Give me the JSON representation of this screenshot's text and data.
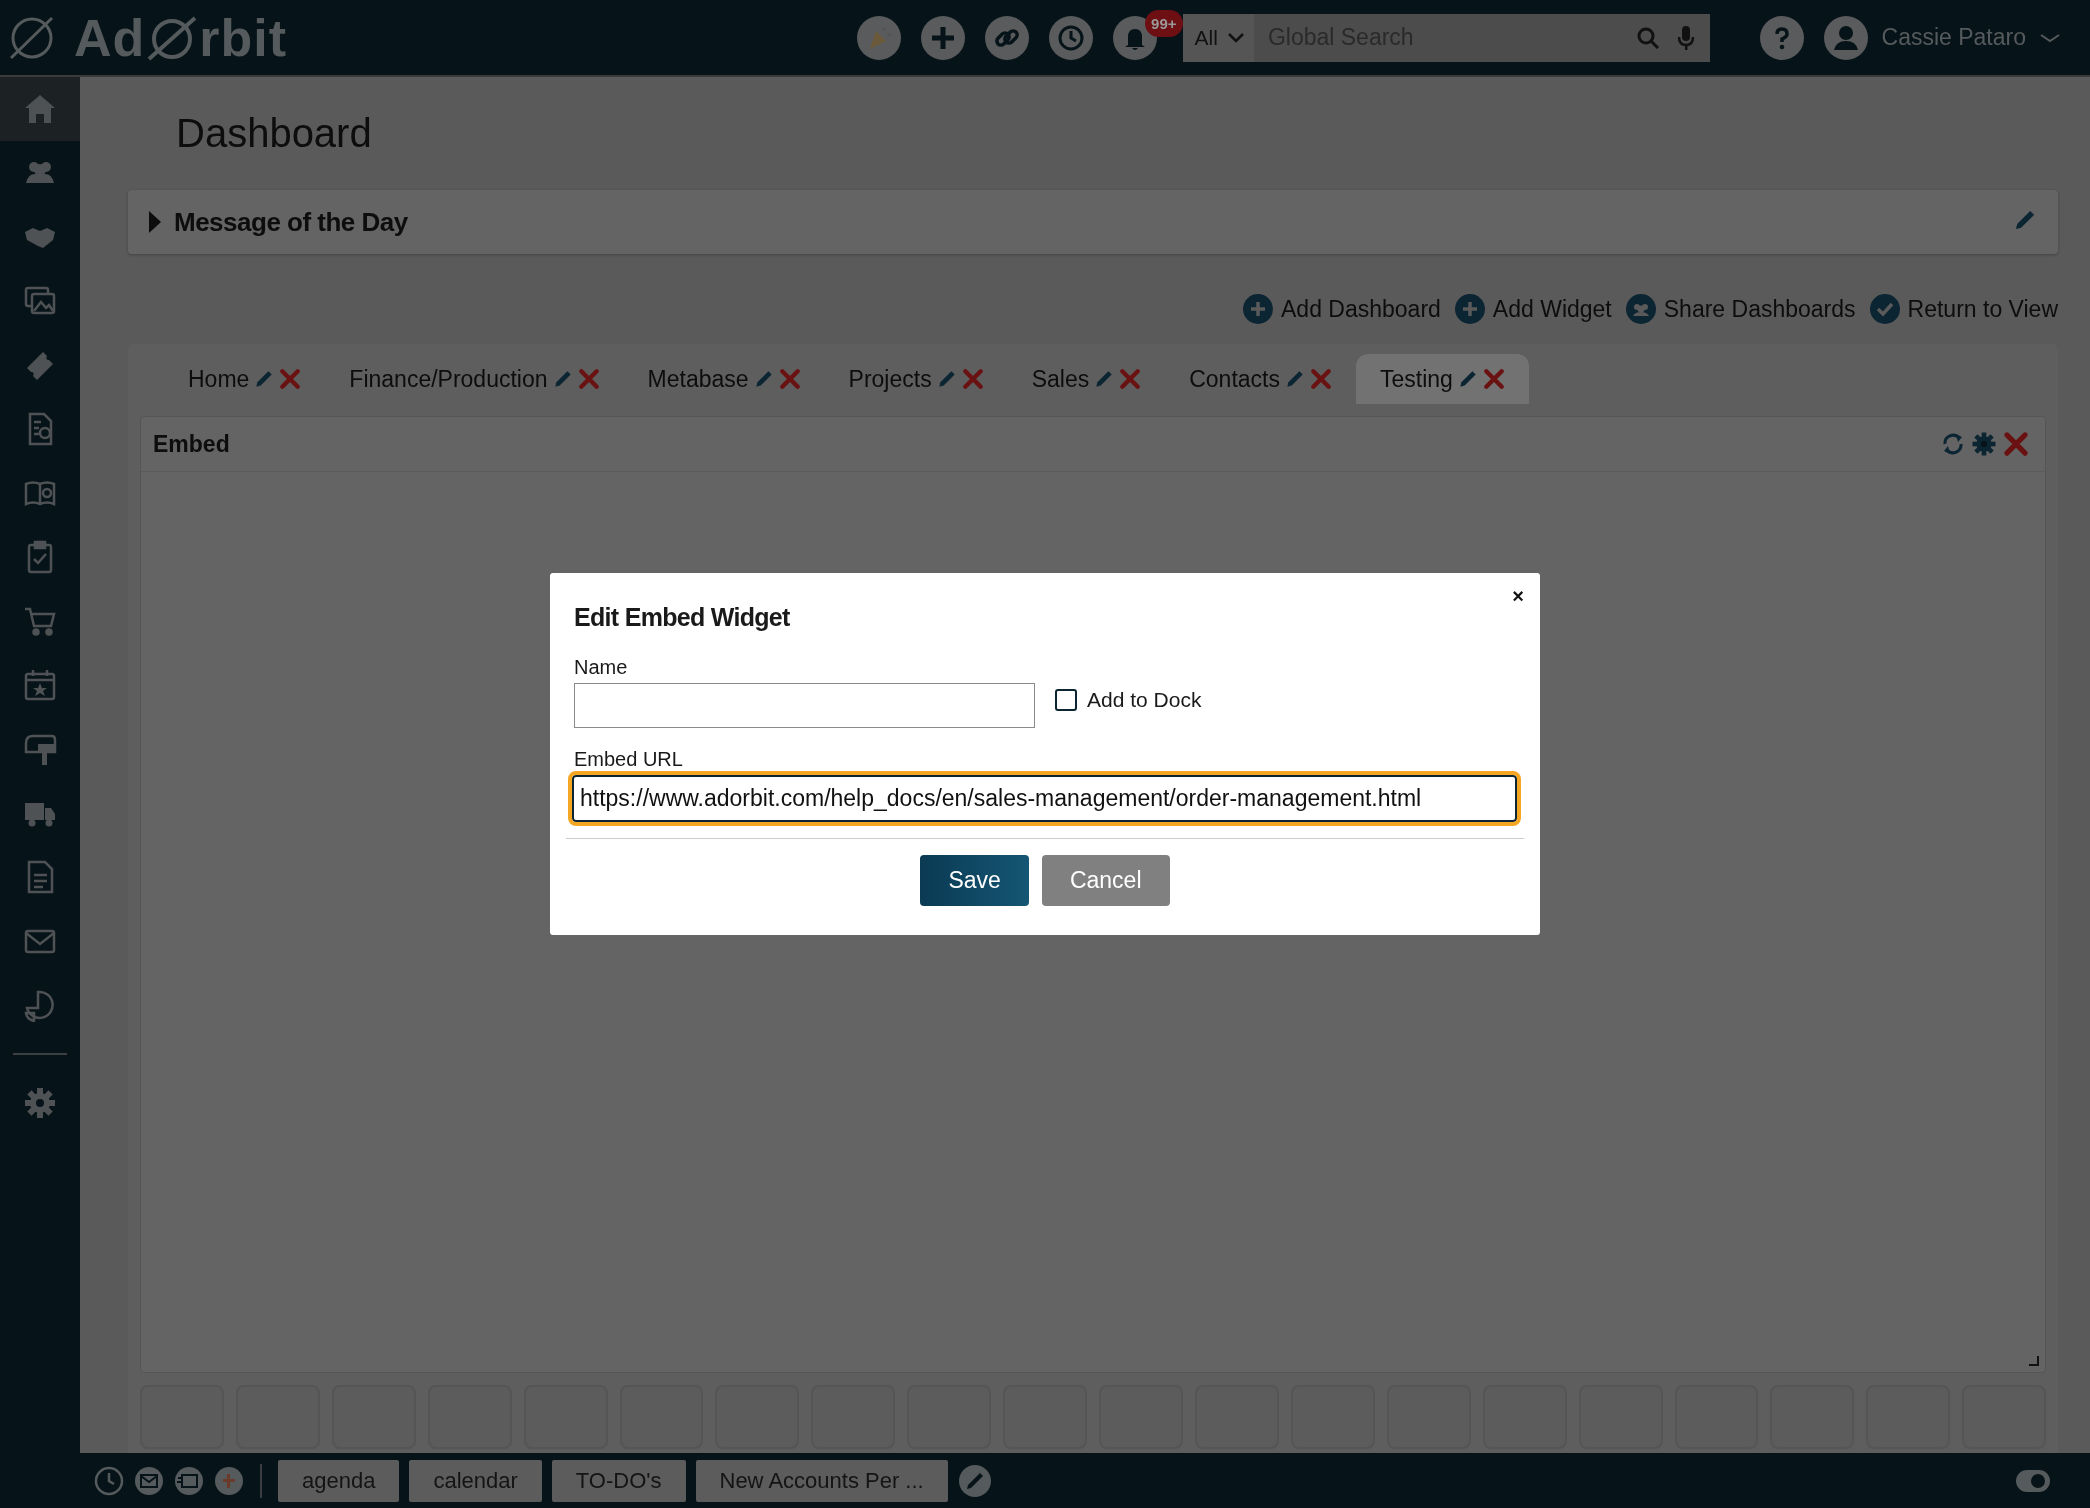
{
  "header": {
    "logo_left": "Ad",
    "logo_right": "rbit",
    "notification_badge": "99+",
    "search": {
      "scope": "All",
      "placeholder": "Global Search"
    },
    "user_name": "Cassie Pataro"
  },
  "sidebar": {
    "items": [
      {
        "selected": true
      },
      {
        "selected": false
      },
      {
        "selected": false
      },
      {
        "selected": false
      },
      {
        "selected": false
      },
      {
        "selected": false
      },
      {
        "selected": false
      },
      {
        "selected": false
      },
      {
        "selected": false
      },
      {
        "selected": false
      },
      {
        "selected": false
      },
      {
        "selected": false
      },
      {
        "selected": false
      },
      {
        "selected": false
      },
      {
        "selected": false
      },
      {
        "selected": false
      }
    ]
  },
  "page_title": "Dashboard",
  "message_of_the_day": {
    "title": "Message of the Day",
    "expanded": false
  },
  "actions": [
    "Add Dashboard",
    "Add Widget",
    "Share Dashboards",
    "Return to View"
  ],
  "tabs": [
    {
      "label": "Home",
      "selected": false
    },
    {
      "label": "Finance/Production",
      "selected": false
    },
    {
      "label": "Metabase",
      "selected": false
    },
    {
      "label": "Projects",
      "selected": false
    },
    {
      "label": "Sales",
      "selected": false
    },
    {
      "label": "Contacts",
      "selected": false
    },
    {
      "label": "Testing",
      "selected": true
    }
  ],
  "widget": {
    "title": "Embed"
  },
  "dialog": {
    "close": "×",
    "title": "Edit Embed Widget",
    "name_label": "Name",
    "add_to_dock": {
      "label": "Add to Dock",
      "checked": false
    },
    "url_label": "Embed URL",
    "url_value": "https://www.adorbit.com/help_docs/en/sales-management/order-management.html",
    "url_focused": true,
    "buttons": [
      {
        "label": "Save",
        "kind": "primary"
      },
      {
        "label": "Cancel",
        "kind": "secondary"
      }
    ]
  },
  "taskbar": [
    "agenda",
    "calendar",
    "TO-DO's",
    "New Accounts Per ..."
  ]
}
